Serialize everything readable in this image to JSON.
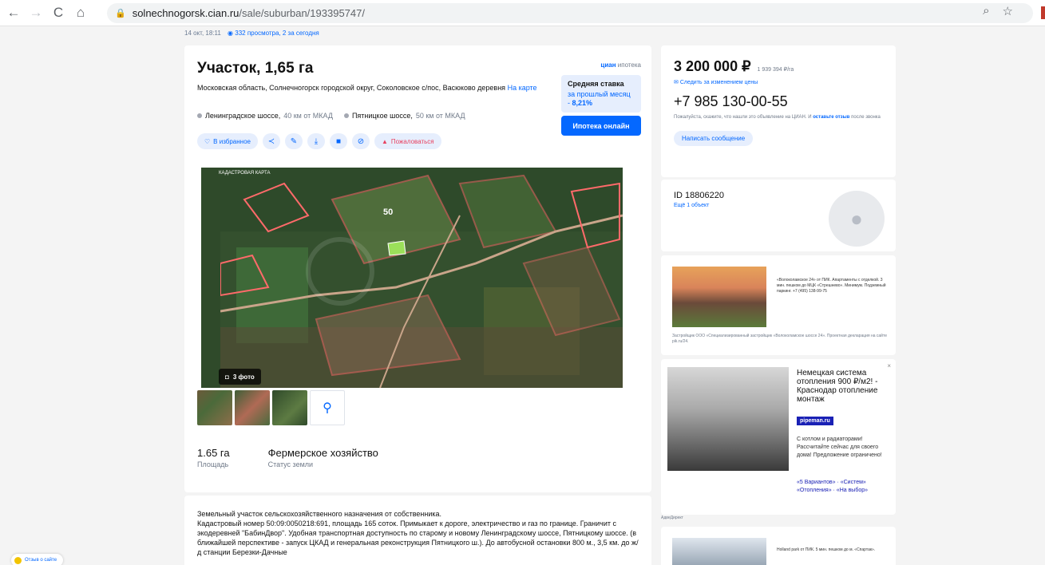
{
  "browser": {
    "back": "←",
    "forward": "→",
    "reload": "C",
    "home": "⌂",
    "url_host": "solnechnogorsk.cian.ru",
    "url_path": "/sale/suburban/193395747/"
  },
  "meta": {
    "date": "14 окт, 18:11",
    "views": "332 просмотра, 2 за сегодня"
  },
  "listing": {
    "title": "Участок, 1,65 га",
    "address": "Московская область, Солнечногорск городской округ, Соколовское с/пос, Васюково деревня",
    "map_link": "На карте",
    "roads": [
      {
        "name": "Ленинградское шоссе,",
        "distance": "40 км от МКАД"
      },
      {
        "name": "Пятницкое шоссе,",
        "distance": "50 км от МКАД"
      }
    ],
    "actions": {
      "favorite": "В избранное",
      "report": "Пожаловаться"
    },
    "photo": {
      "map_label": "КАДАСТРОВАЯ КАРТА",
      "plot_number": "50",
      "count_label": "3 фото"
    },
    "facts": [
      {
        "value": "1.65 га",
        "label": "Площадь"
      },
      {
        "value": "Фермерское хозяйство",
        "label": "Статус земли"
      }
    ],
    "description": [
      "Земельный участок сельскохозяйственного назначения от собственника.",
      "Кадастровый номер 50:09:0050218:691, площадь 165 соток. Примыкает к дороге, электричество и газ по границе. Граничит с экодеревней \"БабинДвор\". Удобная транспортная доступность по старому и новому Ленинградскому шоссе, Пятницкому шоссе. (в ближайшей перспективе - запуск ЦКАД и генеральная реконструкция Пятницкого ш.). До автобусной остановки 800 м., 3,5 км. до ж/д станции Березки-Дачные"
    ]
  },
  "ipoteka": {
    "logo_brand": "циан",
    "logo_word": "ипотека",
    "rate_title": "Средняя ставка",
    "rate_period": "за прошлый месяц -",
    "rate_value": "8,21%",
    "button": "Ипотека онлайн"
  },
  "seller": {
    "price": "3 200 000 ₽",
    "price_per": "1 939 394 ₽/га",
    "price_watch": "Следить за изменением цены",
    "phone": "+7 985 130-00-55",
    "phone_note": "Пожалуйста, скажите, что нашли это объявление на ЦИАН. И",
    "phone_note_link": "оставьте отзыв",
    "phone_note_end": "после звонка",
    "message_button": "Написать сообщение",
    "agent_id": "ID 18806220",
    "agent_more": "Ещё 1 объект"
  },
  "ads": {
    "ad1_text": "«Волоколамское 24» от ПИК. Апартаменты с отделкой. 3 мин. пешком до МЦК «Стрешнево». Минимум. Подземный паркинг. +7 (495) 138-99-75",
    "ad1_footer": "Застройщик ООО «Специализированный застройщик «Волоколамское шоссе 24». Проектная декларация на сайте pik.ru/24.",
    "ad2_title": "Немецкая система отопления 900 ₽/м2! - Краснодар отопление монтаж",
    "ad2_badge": "pipeman.ru",
    "ad2_body": "С котлом и радиаторами! Рассчитайте сейчас для своего дома! Предложение ограничено!",
    "ad2_links": "«5 Вариантов» · «Систем» «Отопления» · «На выбор»",
    "ad2_close": "×",
    "ad_label": "АдвеДирект",
    "ad3_text": "Holland park от ПИК. 5 мин. пешком до м. «Спартак»."
  },
  "feedback": "Отзыв о сайте",
  "colors": {
    "accent": "#0468ff",
    "accent_light": "#e6eefd",
    "report": "#e84260",
    "ad_badge": "#1a21b5"
  }
}
